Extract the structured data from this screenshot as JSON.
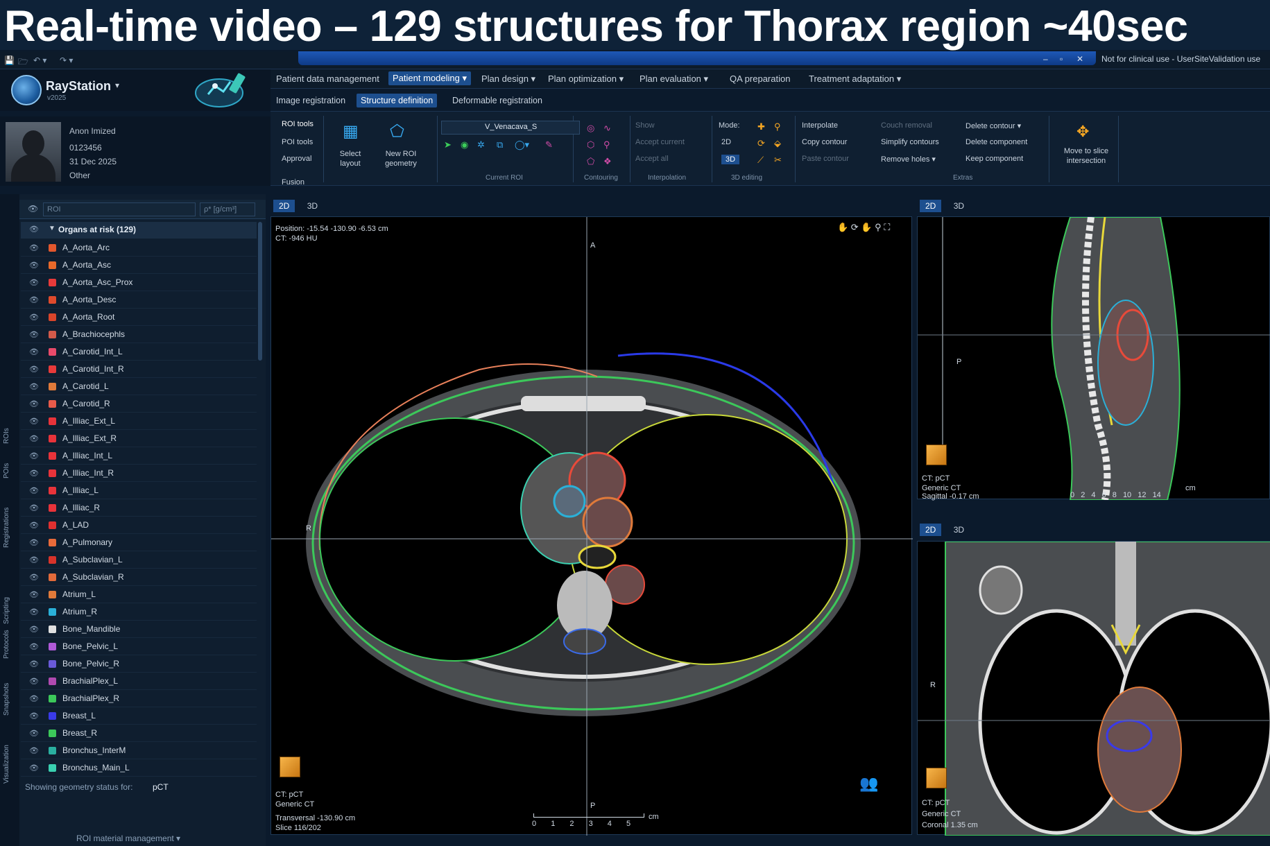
{
  "banner": {
    "title": "Real-time video – 129 structures for Thorax region ~40sec"
  },
  "window": {
    "clinical_note": "Not for clinical use - UserSiteValidation use",
    "qat": [
      "💾",
      "🗁",
      "↶ ▾",
      "↷ ▾"
    ],
    "controls": [
      "–",
      "▫",
      "✕"
    ]
  },
  "brand": {
    "name": "RayStation",
    "version": "v2025",
    "chevron": "▾"
  },
  "patient": {
    "name": "Anon Imized",
    "id": "0123456",
    "date": "31 Dec 2025",
    "sex": "Other"
  },
  "menu": {
    "items": [
      "Patient data management",
      "Patient modeling ▾",
      "Plan design ▾",
      "Plan optimization ▾",
      "Plan evaluation ▾",
      "QA preparation",
      "Treatment adaptation ▾"
    ],
    "active_index": 1
  },
  "subtabs": [
    "Image registration",
    "Structure definition",
    "Deformable registration"
  ],
  "ribbon": {
    "side_tabs": [
      "ROI tools",
      "POI tools",
      "Approval",
      "Fusion"
    ],
    "select_layout": "Select layout",
    "new_roi_geometry": "New ROI geometry",
    "current_roi_value": "V_Venacava_S",
    "current_roi_label": "Current ROI",
    "contouring_label": "Contouring",
    "interpolation": {
      "show": "Show",
      "accept_current": "Accept current",
      "accept_all": "Accept all",
      "label": "Interpolation"
    },
    "editing": {
      "mode": "Mode:",
      "mode_2d": "2D",
      "mode_3d": "3D",
      "label": "3D editing"
    },
    "extras": {
      "interpolate": "Interpolate",
      "copy_contour": "Copy contour",
      "paste_contour": "Paste contour",
      "couch_removal": "Couch removal",
      "simplify_contours": "Simplify contours",
      "remove_holes": "Remove holes ▾",
      "delete_contour": "Delete contour ▾",
      "delete_component": "Delete component",
      "keep_component": "Keep component",
      "label": "Extras"
    },
    "move_to_slice": "Move to slice intersection"
  },
  "sidebar_tabs": [
    "ROIs",
    "POIs",
    "Registrations",
    "Scripting",
    "Protocols",
    "Snapshots",
    "Visualization"
  ],
  "roi_panel": {
    "search_placeholder": "ROI",
    "density_placeholder": "ρ* [g/cm³]",
    "group_label": "Organs at risk (129)",
    "rows": [
      {
        "name": "A_Aorta_Arc",
        "color": "#e2572d"
      },
      {
        "name": "A_Aorta_Asc",
        "color": "#e8692a"
      },
      {
        "name": "A_Aorta_Asc_Prox",
        "color": "#e83a3a"
      },
      {
        "name": "A_Aorta_Desc",
        "color": "#df4a2c"
      },
      {
        "name": "A_Aorta_Root",
        "color": "#d9452a"
      },
      {
        "name": "A_Brachiocephls",
        "color": "#d35a4a"
      },
      {
        "name": "A_Carotid_Int_L",
        "color": "#e84a6a"
      },
      {
        "name": "A_Carotid_Int_R",
        "color": "#e83a3a"
      },
      {
        "name": "A_Carotid_L",
        "color": "#e07a3a"
      },
      {
        "name": "A_Carotid_R",
        "color": "#e85a4a"
      },
      {
        "name": "A_Illiac_Ext_L",
        "color": "#e8333a"
      },
      {
        "name": "A_Illiac_Ext_R",
        "color": "#e8333a"
      },
      {
        "name": "A_Illiac_Int_L",
        "color": "#e8333a"
      },
      {
        "name": "A_Illiac_Int_R",
        "color": "#e8333a"
      },
      {
        "name": "A_Illiac_L",
        "color": "#e8333a"
      },
      {
        "name": "A_Illiac_R",
        "color": "#e8333a"
      },
      {
        "name": "A_LAD",
        "color": "#e03030"
      },
      {
        "name": "A_Pulmonary",
        "color": "#e86a3a"
      },
      {
        "name": "A_Subclavian_L",
        "color": "#d8332a"
      },
      {
        "name": "A_Subclavian_R",
        "color": "#e26a3a"
      },
      {
        "name": "Atrium_L",
        "color": "#e07a3a"
      },
      {
        "name": "Atrium_R",
        "color": "#2ab0d8"
      },
      {
        "name": "Bone_Mandible",
        "color": "#e0e0e0"
      },
      {
        "name": "Bone_Pelvic_L",
        "color": "#b05ad8"
      },
      {
        "name": "Bone_Pelvic_R",
        "color": "#6a5ad8"
      },
      {
        "name": "BrachialPlex_L",
        "color": "#b04ab0"
      },
      {
        "name": "BrachialPlex_R",
        "color": "#3cc85a"
      },
      {
        "name": "Breast_L",
        "color": "#3a3ae8"
      },
      {
        "name": "Breast_R",
        "color": "#3cc85a"
      },
      {
        "name": "Bronchus_InterM",
        "color": "#2ab0a0"
      },
      {
        "name": "Bronchus_Main_L",
        "color": "#3ad0b0"
      }
    ],
    "geometry_status_label": "Showing geometry status for:",
    "geometry_status_value": "pCT",
    "material_management": "ROI material management ▾"
  },
  "views": {
    "tab_2d": "2D",
    "tab_3d": "3D",
    "transversal": {
      "position": "Position: -15.54 -130.90 -6.53 cm",
      "ct_value": "CT: -946 HU",
      "label_a": "A",
      "label_r": "R",
      "label_p": "P",
      "ct_name": "CT: pCT",
      "ct_type": "Generic CT",
      "orientation": "Transversal -130.90 cm",
      "slice": "Slice 116/202",
      "scale_ticks": [
        "0",
        "1",
        "2",
        "3",
        "4",
        "5"
      ],
      "scale_unit": "cm"
    },
    "sagittal": {
      "label_p": "P",
      "ct_name": "CT: pCT",
      "ct_type": "Generic CT",
      "orientation": "Sagittal -0.17 cm",
      "scale_ticks": [
        "0",
        "2",
        "4",
        "6",
        "8",
        "10",
        "12",
        "14"
      ],
      "scale_unit": "cm"
    },
    "coronal": {
      "label_r": "R",
      "ct_name": "CT: pCT",
      "ct_type": "Generic CT",
      "orientation": "Coronal 1.35 cm"
    }
  },
  "colors": {
    "accent": "#1d4f8f",
    "background": "#0b1a2c",
    "panel": "#0f1e2f"
  }
}
